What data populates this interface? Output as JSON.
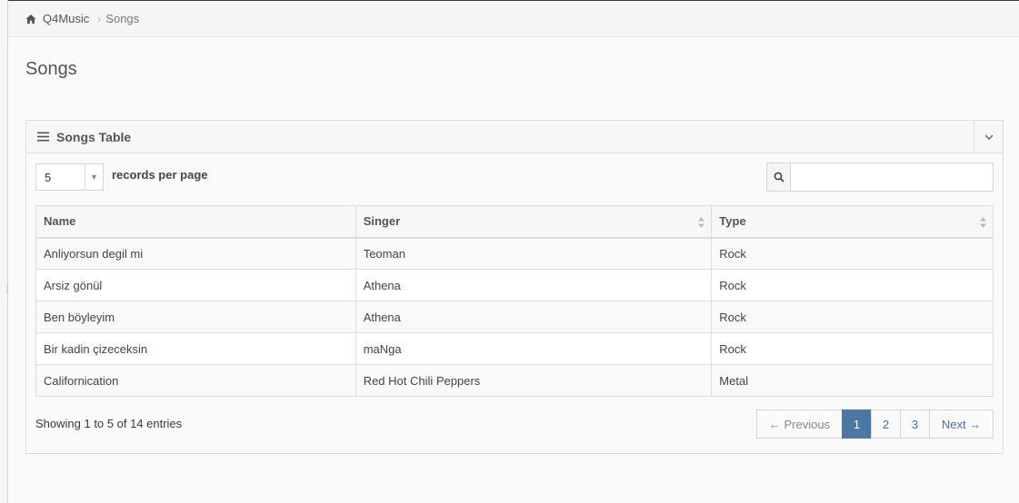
{
  "breadcrumb": {
    "home_label": "Q4Music",
    "separator": ">",
    "current": "Songs"
  },
  "page": {
    "title": "Songs"
  },
  "widget": {
    "title": "Songs Table",
    "collapse_icon": "chevron-down-icon",
    "menu_icon": "list-icon"
  },
  "controls": {
    "page_length_value": "5",
    "page_length_label": "records per page",
    "search_placeholder": "",
    "search_value": ""
  },
  "table": {
    "columns": [
      "Name",
      "Singer",
      "Type"
    ],
    "rows": [
      {
        "name": "Anliyorsun degil mi",
        "singer": "Teoman",
        "type": "Rock"
      },
      {
        "name": "Arsiz gönül",
        "singer": "Athena",
        "type": "Rock"
      },
      {
        "name": "Ben böyleyim",
        "singer": "Athena",
        "type": "Rock"
      },
      {
        "name": "Bir kadin çizeceksin",
        "singer": "maNga",
        "type": "Rock"
      },
      {
        "name": "Californication",
        "singer": "Red Hot Chili Peppers",
        "type": "Metal"
      }
    ]
  },
  "footer": {
    "info": "Showing 1 to 5 of 14 entries",
    "pagination": {
      "previous": "← Previous",
      "pages": [
        "1",
        "2",
        "3"
      ],
      "active_page": "1",
      "next": "Next →"
    }
  },
  "colors": {
    "active_page": "#4f77a4",
    "border": "#dddddd"
  }
}
